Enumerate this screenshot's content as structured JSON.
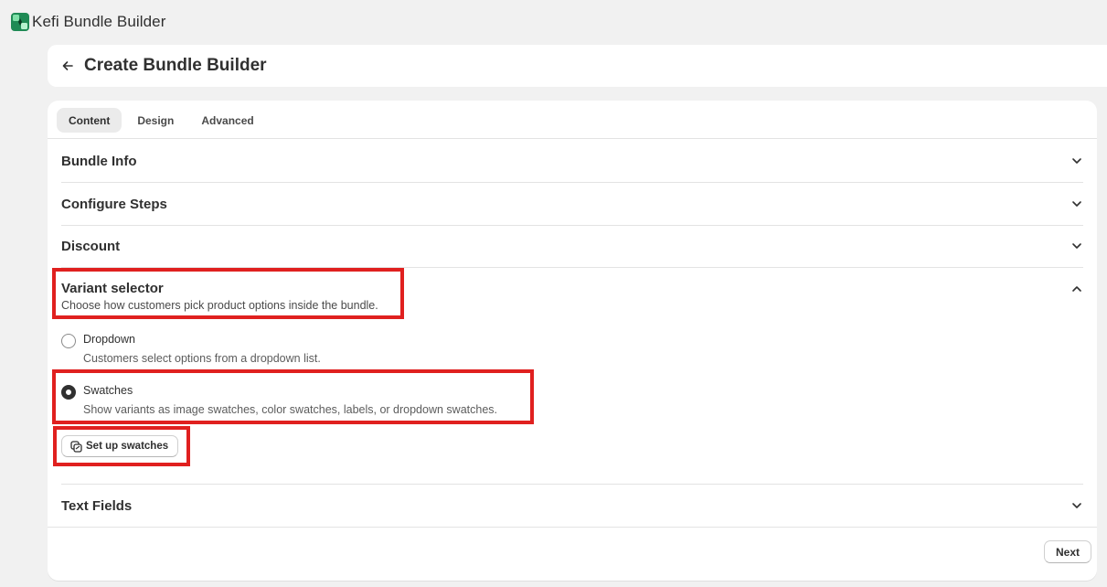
{
  "app": {
    "title": "Kefi Bundle Builder",
    "logo_icon": "kefi-logo-icon"
  },
  "page": {
    "title": "Create Bundle Builder",
    "back_icon": "arrow-left-icon"
  },
  "tabs": [
    {
      "label": "Content",
      "active": true
    },
    {
      "label": "Design",
      "active": false
    },
    {
      "label": "Advanced",
      "active": false
    }
  ],
  "sections": {
    "bundle_info": {
      "title": "Bundle Info",
      "expanded": false
    },
    "configure_steps": {
      "title": "Configure Steps",
      "expanded": false
    },
    "discount": {
      "title": "Discount",
      "expanded": false
    },
    "variant_selector": {
      "title": "Variant selector",
      "description": "Choose how customers pick product options inside the bundle.",
      "expanded": true,
      "options": [
        {
          "label": "Dropdown",
          "help": "Customers select options from a dropdown list.",
          "selected": false
        },
        {
          "label": "Swatches",
          "help": "Show variants as image swatches, color swatches, labels, or dropdown swatches.",
          "selected": true
        }
      ],
      "setup_button": "Set up swatches"
    },
    "text_fields": {
      "title": "Text Fields",
      "expanded": false
    }
  },
  "footer": {
    "next_label": "Next"
  },
  "colors": {
    "highlight": "#e0201f",
    "background": "#f1f1f1",
    "card": "#ffffff",
    "text": "#303030"
  }
}
